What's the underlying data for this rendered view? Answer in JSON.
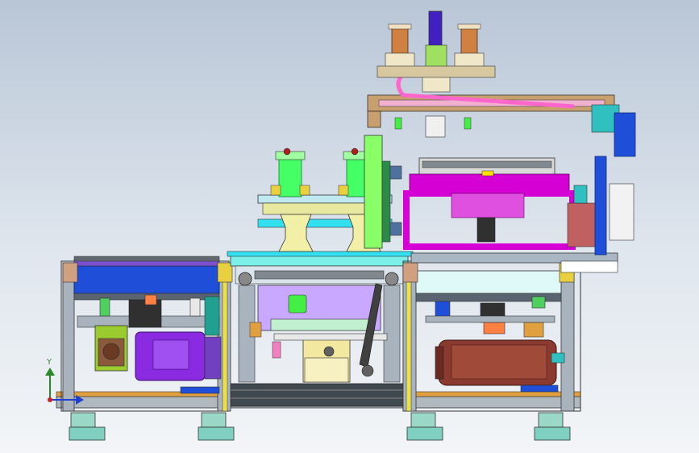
{
  "viewport": {
    "background_top": "#b9c6d6",
    "background_bottom": "#f3f5f7"
  },
  "palette": {
    "frame_blue": "#1f4fd8",
    "frame_cyan": "#33e0f0",
    "frame_grey": "#9fa7b0",
    "motor_purple": "#8a2be2",
    "motor_brown": "#8b3a2f",
    "fixture_magenta": "#d400d4",
    "fixture_pink": "#ff66cc",
    "arm_tan": "#c8a070",
    "cylinder_copper": "#d08040",
    "cylinder_green": "#44ff66",
    "pedestal_cream": "#f2f0a6",
    "light_violet": "#c9a8ff",
    "bracket_orange": "#e0a040",
    "foot_teal": "#7fd0c0"
  },
  "triad": {
    "y_label": "Y"
  }
}
